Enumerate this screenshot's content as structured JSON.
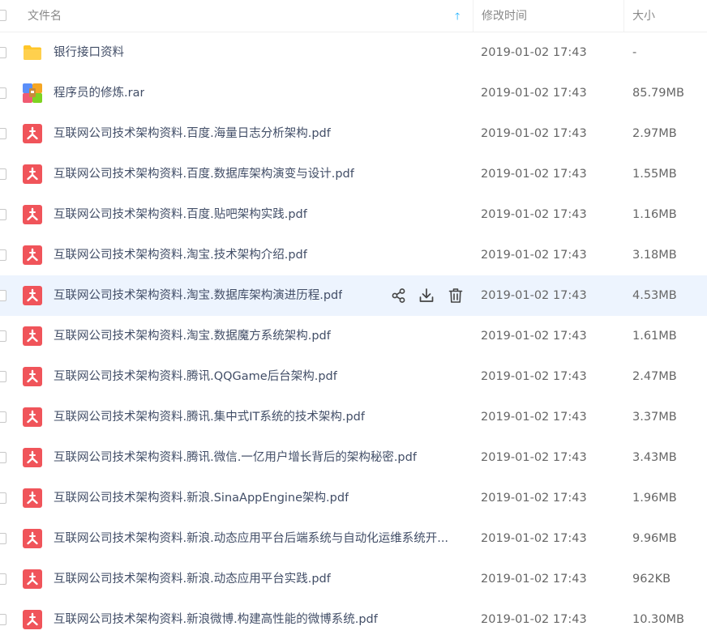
{
  "columns": {
    "name": "文件名",
    "sort_icon": "sort-ascending-arrow-icon",
    "mtime": "修改时间",
    "size": "大小"
  },
  "colors": {
    "pdf_red": "#f0545a",
    "folder_yellow": "#ffc629",
    "hover_row": "#edf4fe",
    "sort_arrow": "#09aaff"
  },
  "hovered_row_actions": [
    "share-icon",
    "download-icon",
    "delete-icon"
  ],
  "files": [
    {
      "name": "银行接口资料",
      "type": "folder",
      "mtime": "2019-01-02 17:43",
      "size": "-"
    },
    {
      "name": "程序员的修炼.rar",
      "type": "rar",
      "mtime": "2019-01-02 17:43",
      "size": "85.79MB"
    },
    {
      "name": "互联网公司技术架构资料.百度.海量日志分析架构.pdf",
      "type": "pdf",
      "mtime": "2019-01-02 17:43",
      "size": "2.97MB"
    },
    {
      "name": "互联网公司技术架构资料.百度.数据库架构演变与设计.pdf",
      "type": "pdf",
      "mtime": "2019-01-02 17:43",
      "size": "1.55MB"
    },
    {
      "name": "互联网公司技术架构资料.百度.贴吧架构实践.pdf",
      "type": "pdf",
      "mtime": "2019-01-02 17:43",
      "size": "1.16MB"
    },
    {
      "name": "互联网公司技术架构资料.淘宝.技术架构介绍.pdf",
      "type": "pdf",
      "mtime": "2019-01-02 17:43",
      "size": "3.18MB"
    },
    {
      "name": "互联网公司技术架构资料.淘宝.数据库架构演进历程.pdf",
      "type": "pdf",
      "mtime": "2019-01-02 17:43",
      "size": "4.53MB",
      "hovered": true
    },
    {
      "name": "互联网公司技术架构资料.淘宝.数据魔方系统架构.pdf",
      "type": "pdf",
      "mtime": "2019-01-02 17:43",
      "size": "1.61MB"
    },
    {
      "name": "互联网公司技术架构资料.腾讯.QQGame后台架构.pdf",
      "type": "pdf",
      "mtime": "2019-01-02 17:43",
      "size": "2.47MB"
    },
    {
      "name": "互联网公司技术架构资料.腾讯.集中式IT系统的技术架构.pdf",
      "type": "pdf",
      "mtime": "2019-01-02 17:43",
      "size": "3.37MB"
    },
    {
      "name": "互联网公司技术架构资料.腾讯.微信.一亿用户增长背后的架构秘密.pdf",
      "type": "pdf",
      "mtime": "2019-01-02 17:43",
      "size": "3.43MB"
    },
    {
      "name": "互联网公司技术架构资料.新浪.SinaAppEngine架构.pdf",
      "type": "pdf",
      "mtime": "2019-01-02 17:43",
      "size": "1.96MB"
    },
    {
      "name": "互联网公司技术架构资料.新浪.动态应用平台后端系统与自动化运维系统开...",
      "type": "pdf",
      "mtime": "2019-01-02 17:43",
      "size": "9.96MB"
    },
    {
      "name": "互联网公司技术架构资料.新浪.动态应用平台实践.pdf",
      "type": "pdf",
      "mtime": "2019-01-02 17:43",
      "size": "962KB"
    },
    {
      "name": "互联网公司技术架构资料.新浪微博.构建高性能的微博系统.pdf",
      "type": "pdf",
      "mtime": "2019-01-02 17:43",
      "size": "10.30MB"
    }
  ]
}
